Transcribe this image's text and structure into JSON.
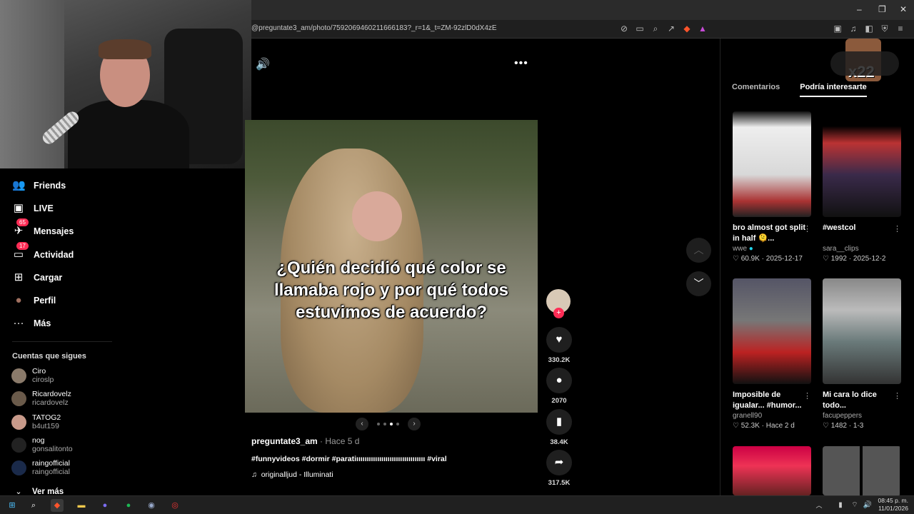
{
  "browser": {
    "url": "@preguntate3_am/photo/7592069460211666183?_r=1&_t=ZM-92zlD0dX4zE",
    "window_controls": [
      "–",
      "❐",
      "✕"
    ]
  },
  "sidebar": {
    "items": [
      {
        "icon": "friends-icon",
        "glyph": "👥",
        "label": "Friends"
      },
      {
        "icon": "live-icon",
        "glyph": "▣",
        "label": "LIVE"
      },
      {
        "icon": "messages-icon",
        "glyph": "✈",
        "label": "Mensajes",
        "badge": "65"
      },
      {
        "icon": "activity-icon",
        "glyph": "▭",
        "label": "Actividad",
        "badge": "17"
      },
      {
        "icon": "upload-icon",
        "glyph": "⊞",
        "label": "Cargar"
      },
      {
        "icon": "profile-icon",
        "glyph": "●",
        "label": "Perfil"
      },
      {
        "icon": "more-icon",
        "glyph": "···",
        "label": "Más"
      }
    ],
    "following_title": "Cuentas que sigues",
    "following": [
      {
        "name": "Ciro",
        "user": "ciroslp"
      },
      {
        "name": "Ricardovelz",
        "user": "ricardovelz"
      },
      {
        "name": "TATOG2",
        "user": "b4ut159"
      },
      {
        "name": "nog",
        "user": "gonsalitonto"
      },
      {
        "name": "raingofficial",
        "user": "raingofficial"
      }
    ],
    "see_more": "Ver más"
  },
  "post": {
    "caption": "¿Quién decidió qué color se llamaba rojo y por qué todos estuvimos de acuerdo?",
    "author": "preguntate3_am",
    "time": "· Hace 5 d",
    "hashtags": "#funnyvideos #dormir #paratiııııııııııııııııııııııııııııııııı #viral",
    "music": "originalljud - Illuminati",
    "likes": "330.2K",
    "comments": "2070",
    "saves": "38.4K",
    "shares": "317.5K"
  },
  "right_panel": {
    "tabs": [
      "Comentarios",
      "Podría interesarte"
    ],
    "active_tab": 1,
    "overlay_text": "x22",
    "cards": [
      {
        "title": "bro almost got split in half 🫠...",
        "user": "wwe",
        "verified": true,
        "likes": "60.9K",
        "date": "2025-12-17"
      },
      {
        "title": "#westcol",
        "user": "sara__clips",
        "verified": false,
        "likes": "1992",
        "date": "2025-12-2"
      },
      {
        "title": "Imposible de igualar... #humor...",
        "user": "granell90",
        "verified": false,
        "likes": "52.3K",
        "date": "Hace 2 d"
      },
      {
        "title": "Mi cara lo dice todo...",
        "user": "facupeppers",
        "verified": false,
        "likes": "1482",
        "date": "1-3"
      }
    ]
  },
  "taskbar": {
    "time": "08:45 p. m.",
    "date": "11/01/2026"
  },
  "colors": {
    "accent": "#fe2c55",
    "background": "#000000"
  }
}
